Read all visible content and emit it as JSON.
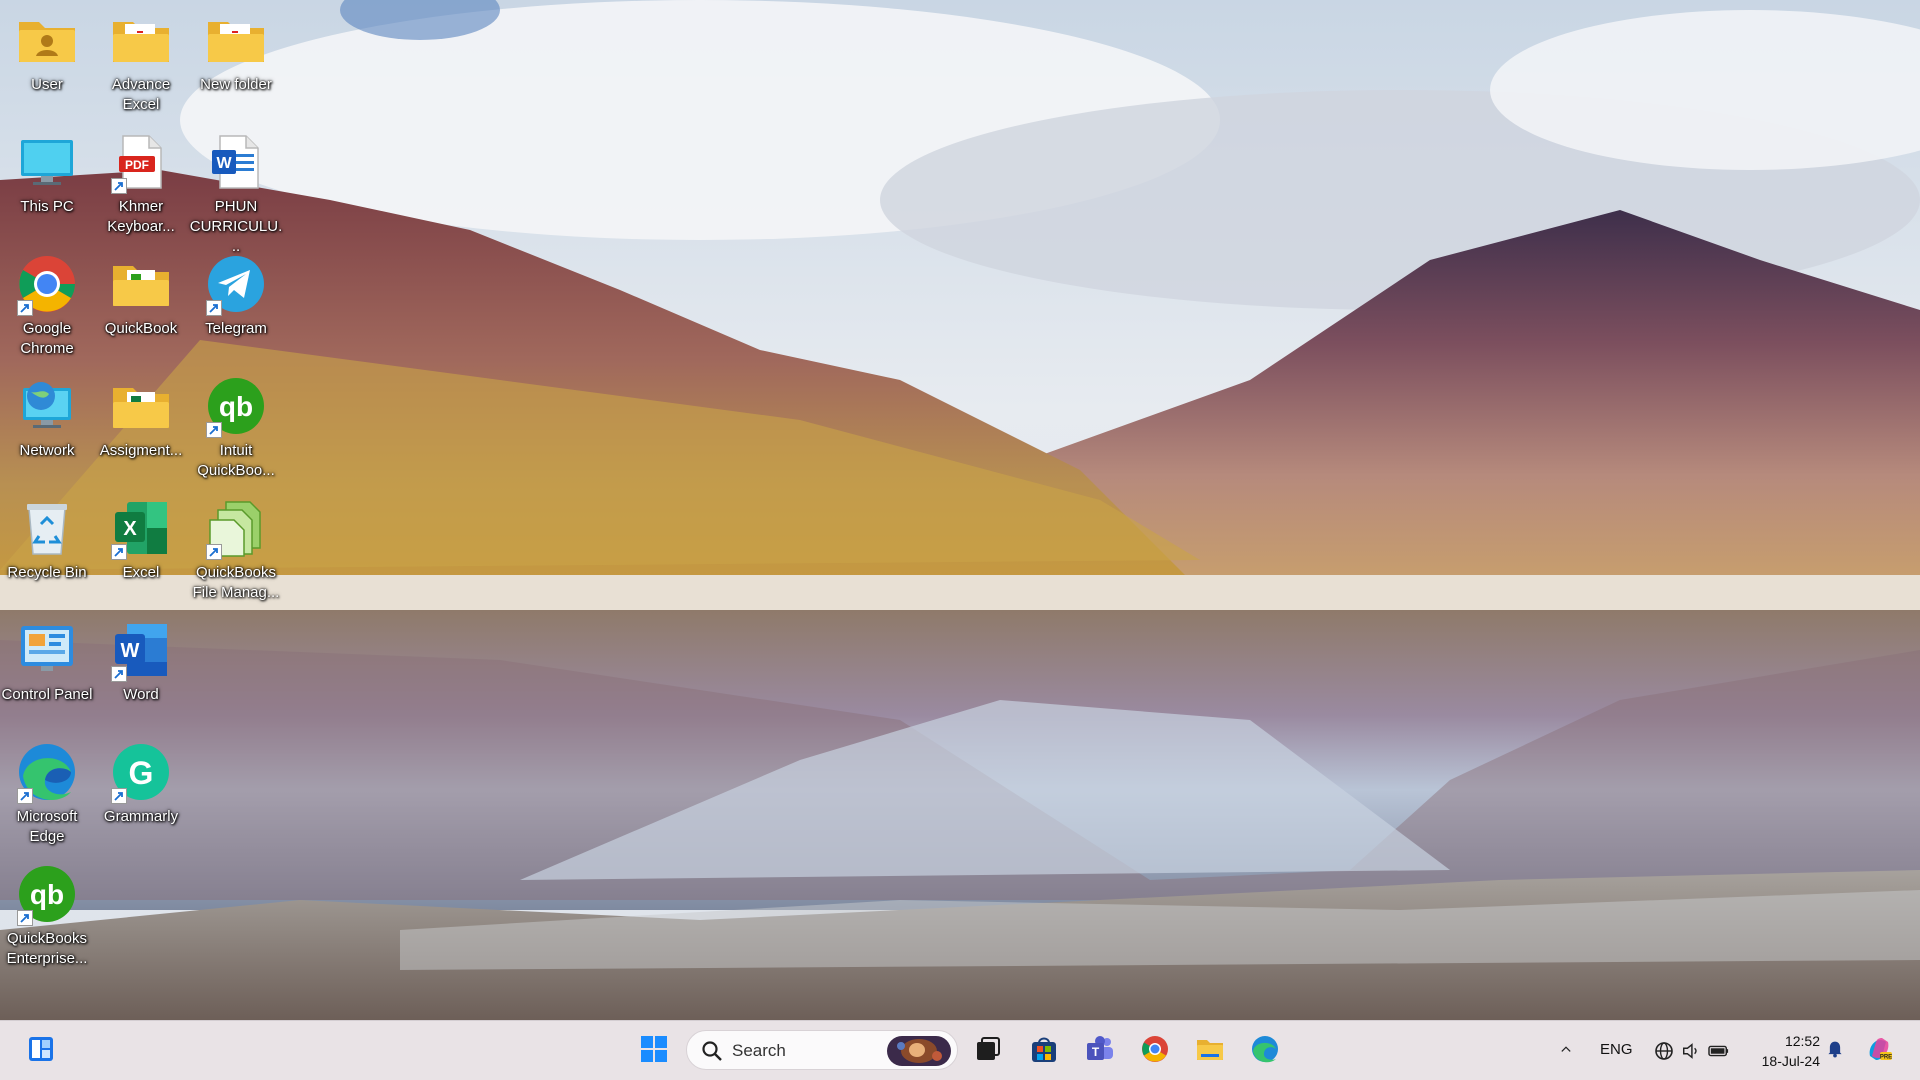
{
  "desktop": {
    "icons": [
      {
        "id": "user",
        "label": "User",
        "icon": "user-folder-icon"
      },
      {
        "id": "advance-excel",
        "label": "Advance Excel",
        "icon": "folder-icon"
      },
      {
        "id": "new-folder",
        "label": "New folder",
        "icon": "folder-icon"
      },
      {
        "id": "this-pc",
        "label": "This PC",
        "icon": "monitor-icon"
      },
      {
        "id": "khmer-keyboard",
        "label": "Khmer Keyboar...",
        "icon": "pdf-icon"
      },
      {
        "id": "phun-curriculum",
        "label": "PHUN CURRICULU...",
        "icon": "word-document-icon"
      },
      {
        "id": "google-chrome",
        "label": "Google Chrome",
        "icon": "chrome-icon"
      },
      {
        "id": "quickbook-folder",
        "label": "QuickBook",
        "icon": "folder-icon"
      },
      {
        "id": "telegram",
        "label": "Telegram",
        "icon": "telegram-icon"
      },
      {
        "id": "network",
        "label": "Network",
        "icon": "network-icon"
      },
      {
        "id": "assignment",
        "label": "Assigment...",
        "icon": "folder-icon"
      },
      {
        "id": "intuit-quickbooks",
        "label": "Intuit QuickBoo...",
        "icon": "quickbooks-icon"
      },
      {
        "id": "recycle-bin",
        "label": "Recycle Bin",
        "icon": "recycle-bin-icon"
      },
      {
        "id": "excel",
        "label": "Excel",
        "icon": "excel-icon"
      },
      {
        "id": "quickbooks-file-manager",
        "label": "QuickBooks File Manag...",
        "icon": "quickbooks-file-manager-icon"
      },
      {
        "id": "control-panel",
        "label": "Control Panel",
        "icon": "control-panel-icon"
      },
      {
        "id": "word",
        "label": "Word",
        "icon": "word-icon"
      },
      {
        "id": "microsoft-edge",
        "label": "Microsoft Edge",
        "icon": "edge-icon"
      },
      {
        "id": "grammarly",
        "label": "Grammarly",
        "icon": "grammarly-icon"
      },
      {
        "id": "quickbooks-enterprise",
        "label": "QuickBooks Enterprise...",
        "icon": "quickbooks-icon"
      }
    ]
  },
  "taskbar": {
    "search_placeholder": "Search",
    "pinned": [
      "start-icon",
      "task-view-icon",
      "microsoft-store-icon",
      "teams-icon",
      "chrome-icon",
      "file-explorer-icon",
      "edge-icon"
    ],
    "language": "ENG",
    "time": "12:52",
    "date": "18-Jul-24"
  },
  "colors": {
    "taskbar_bg": "#e9e3e6",
    "folder_yellow": "#f7c948",
    "excel_green": "#107c41",
    "word_blue": "#185abd",
    "quickbooks_green": "#2ca01c",
    "telegram_blue": "#2aa3df",
    "grammarly_green": "#15c39a"
  }
}
